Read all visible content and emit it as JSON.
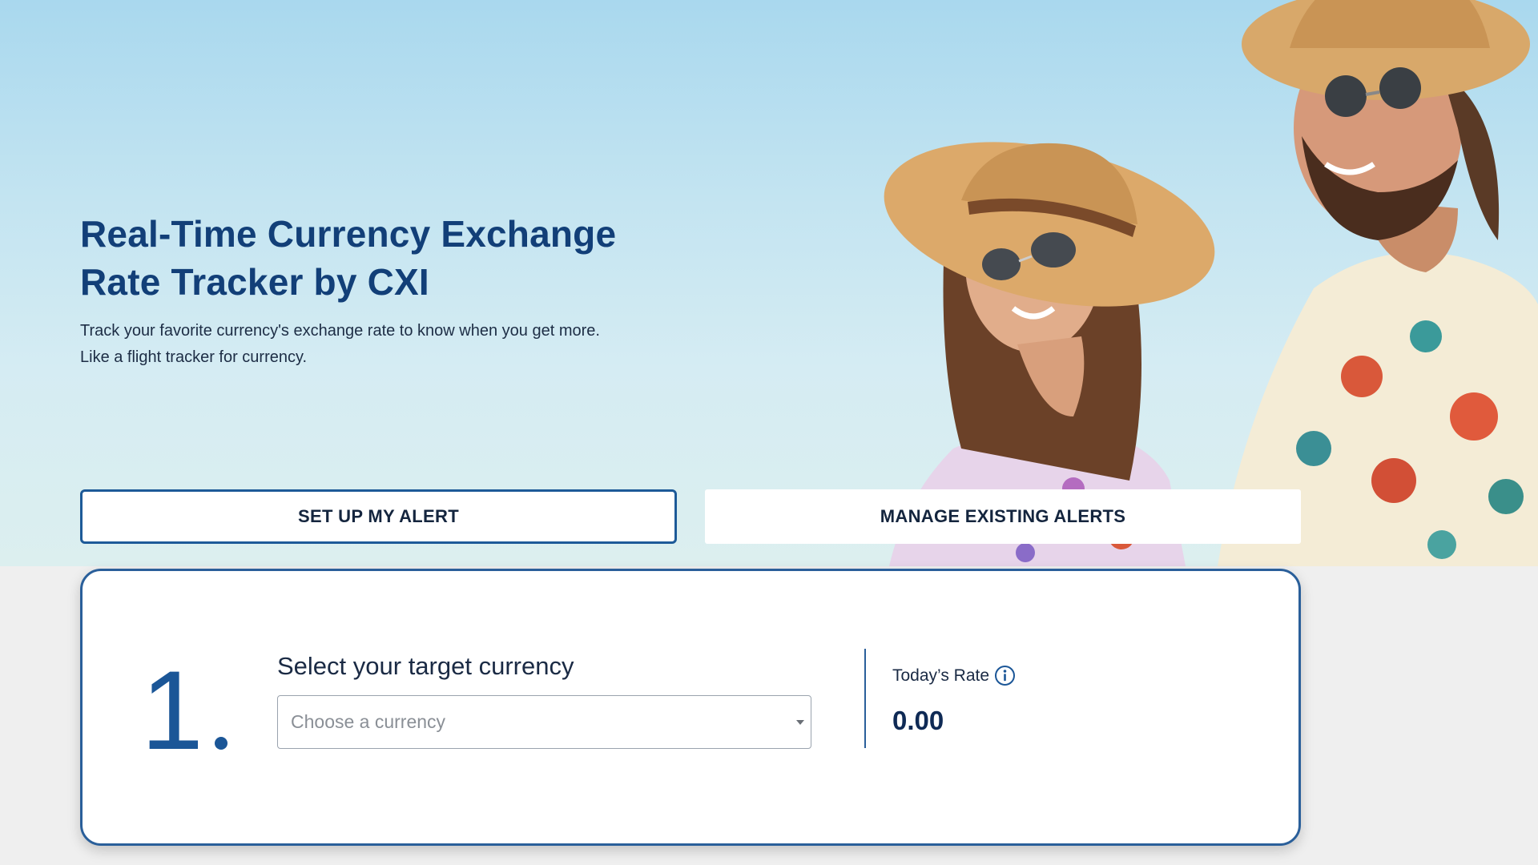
{
  "hero": {
    "title": "Real-Time Currency Exchange Rate Tracker by CXI",
    "subtitle_line1": "Track your favorite currency's exchange rate to know when you get more.",
    "subtitle_line2": "Like a flight tracker for currency."
  },
  "tabs": {
    "setup_label": "SET UP MY ALERT",
    "manage_label": "MANAGE EXISTING ALERTS",
    "active": "setup"
  },
  "step": {
    "number": "1",
    "select_label": "Select your target currency",
    "select_placeholder": "Choose a currency",
    "rate_label": "Today’s Rate",
    "rate_value": "0.00"
  },
  "colors": {
    "brand_blue": "#1b5697",
    "title_navy": "#123f78"
  },
  "icons": {
    "info": "info-circle-icon",
    "caret": "chevron-down-icon"
  }
}
